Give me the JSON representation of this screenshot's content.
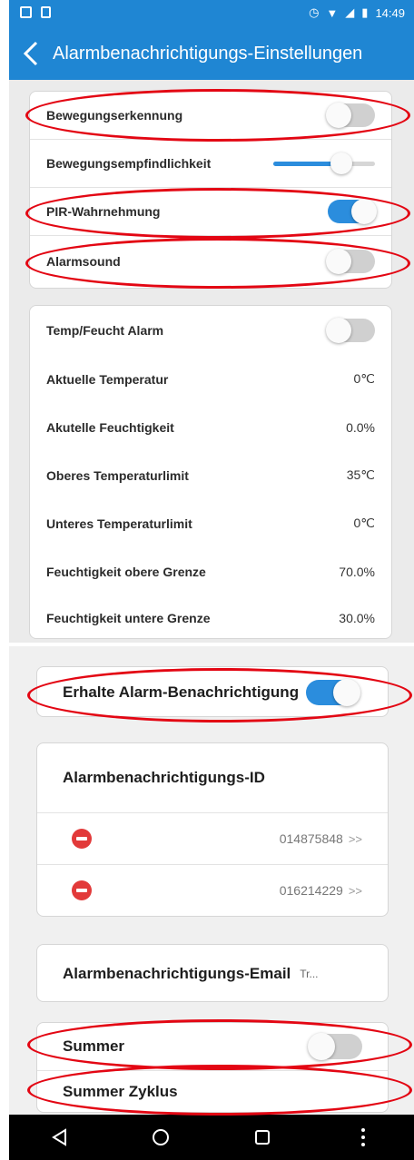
{
  "status_bar": {
    "time": "14:49"
  },
  "app_bar": {
    "title": "Alarmbenachrichtigungs-Einstellungen"
  },
  "motion": {
    "detection_label": "Bewegungserkennung",
    "detection_on": false,
    "sensitivity_label": "Bewegungsempfindlichkeit",
    "sensitivity_fraction": 0.72,
    "pir_label": "PIR-Wahrnehmung",
    "pir_on": true,
    "sound_label": "Alarmsound",
    "sound_on": false
  },
  "temp": {
    "alarm_label": "Temp/Feucht Alarm",
    "alarm_on": false,
    "current_temp_label": "Aktuelle Temperatur",
    "current_temp": "0℃",
    "current_hum_label": "Akutelle Feuchtigkeit",
    "current_hum": "0.0%",
    "upper_temp_label": "Oberes Temperaturlimit",
    "upper_temp": "35℃",
    "lower_temp_label": "Unteres Temperaturlimit",
    "lower_temp": "0℃",
    "hum_upper_label": "Feuchtigkeit obere Grenze",
    "hum_upper": "70.0%",
    "hum_lower_label": "Feuchtigkeit untere Grenze",
    "hum_lower": "30.0%"
  },
  "notification": {
    "label": "Erhalte Alarm-Benachrichtigung",
    "on": true
  },
  "ids": {
    "title": "Alarmbenachrichtigungs-ID",
    "items": [
      {
        "id": "014875848",
        "chevron": ">>"
      },
      {
        "id": "016214229",
        "chevron": ">>"
      }
    ]
  },
  "email": {
    "label": "Alarmbenachrichtigungs-Email",
    "value": "Tr..."
  },
  "buzzer": {
    "label": "Summer",
    "on": false,
    "cycle_label": "Summer Zyklus"
  },
  "colors": {
    "accent": "#2b8ddd",
    "appbar": "#1f86d3",
    "annotation": "#e30613"
  }
}
